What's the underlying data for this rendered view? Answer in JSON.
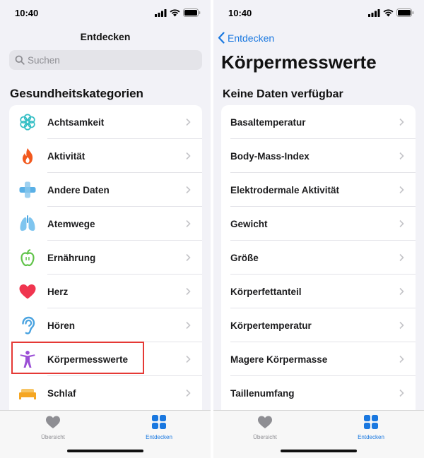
{
  "left": {
    "time": "10:40",
    "nav_title": "Entdecken",
    "search_placeholder": "Suchen",
    "section_title": "Gesundheitskategorien",
    "items": [
      {
        "label": "Achtsamkeit",
        "icon": "mindfulness-icon"
      },
      {
        "label": "Aktivität",
        "icon": "flame-icon"
      },
      {
        "label": "Andere Daten",
        "icon": "plus-icon"
      },
      {
        "label": "Atemwege",
        "icon": "lungs-icon"
      },
      {
        "label": "Ernährung",
        "icon": "apple-icon"
      },
      {
        "label": "Herz",
        "icon": "heart-icon"
      },
      {
        "label": "Hören",
        "icon": "ear-icon"
      },
      {
        "label": "Körpermesswerte",
        "icon": "body-figure-icon"
      },
      {
        "label": "Schlaf",
        "icon": "bed-icon"
      }
    ],
    "tabs": [
      {
        "label": "Übersicht",
        "icon": "heart-tab-icon",
        "active": false
      },
      {
        "label": "Entdecken",
        "icon": "grid-tab-icon",
        "active": true
      }
    ]
  },
  "right": {
    "time": "10:40",
    "back_label": "Entdecken",
    "large_title": "Körpermesswerte",
    "section_title": "Keine Daten verfügbar",
    "items": [
      {
        "label": "Basaltemperatur"
      },
      {
        "label": "Body-Mass-Index"
      },
      {
        "label": "Elektrodermale Aktivität"
      },
      {
        "label": "Gewicht"
      },
      {
        "label": "Größe"
      },
      {
        "label": "Körperfettanteil"
      },
      {
        "label": "Körpertemperatur"
      },
      {
        "label": "Magere Körpermasse"
      },
      {
        "label": "Taillenumfang"
      }
    ],
    "tabs": [
      {
        "label": "Übersicht",
        "icon": "heart-tab-icon",
        "active": false
      },
      {
        "label": "Entdecken",
        "icon": "grid-tab-icon",
        "active": true
      }
    ]
  },
  "colors": {
    "accent": "#1a78e0",
    "highlight": "#e53935",
    "inactive_tab": "#8e8e93"
  }
}
